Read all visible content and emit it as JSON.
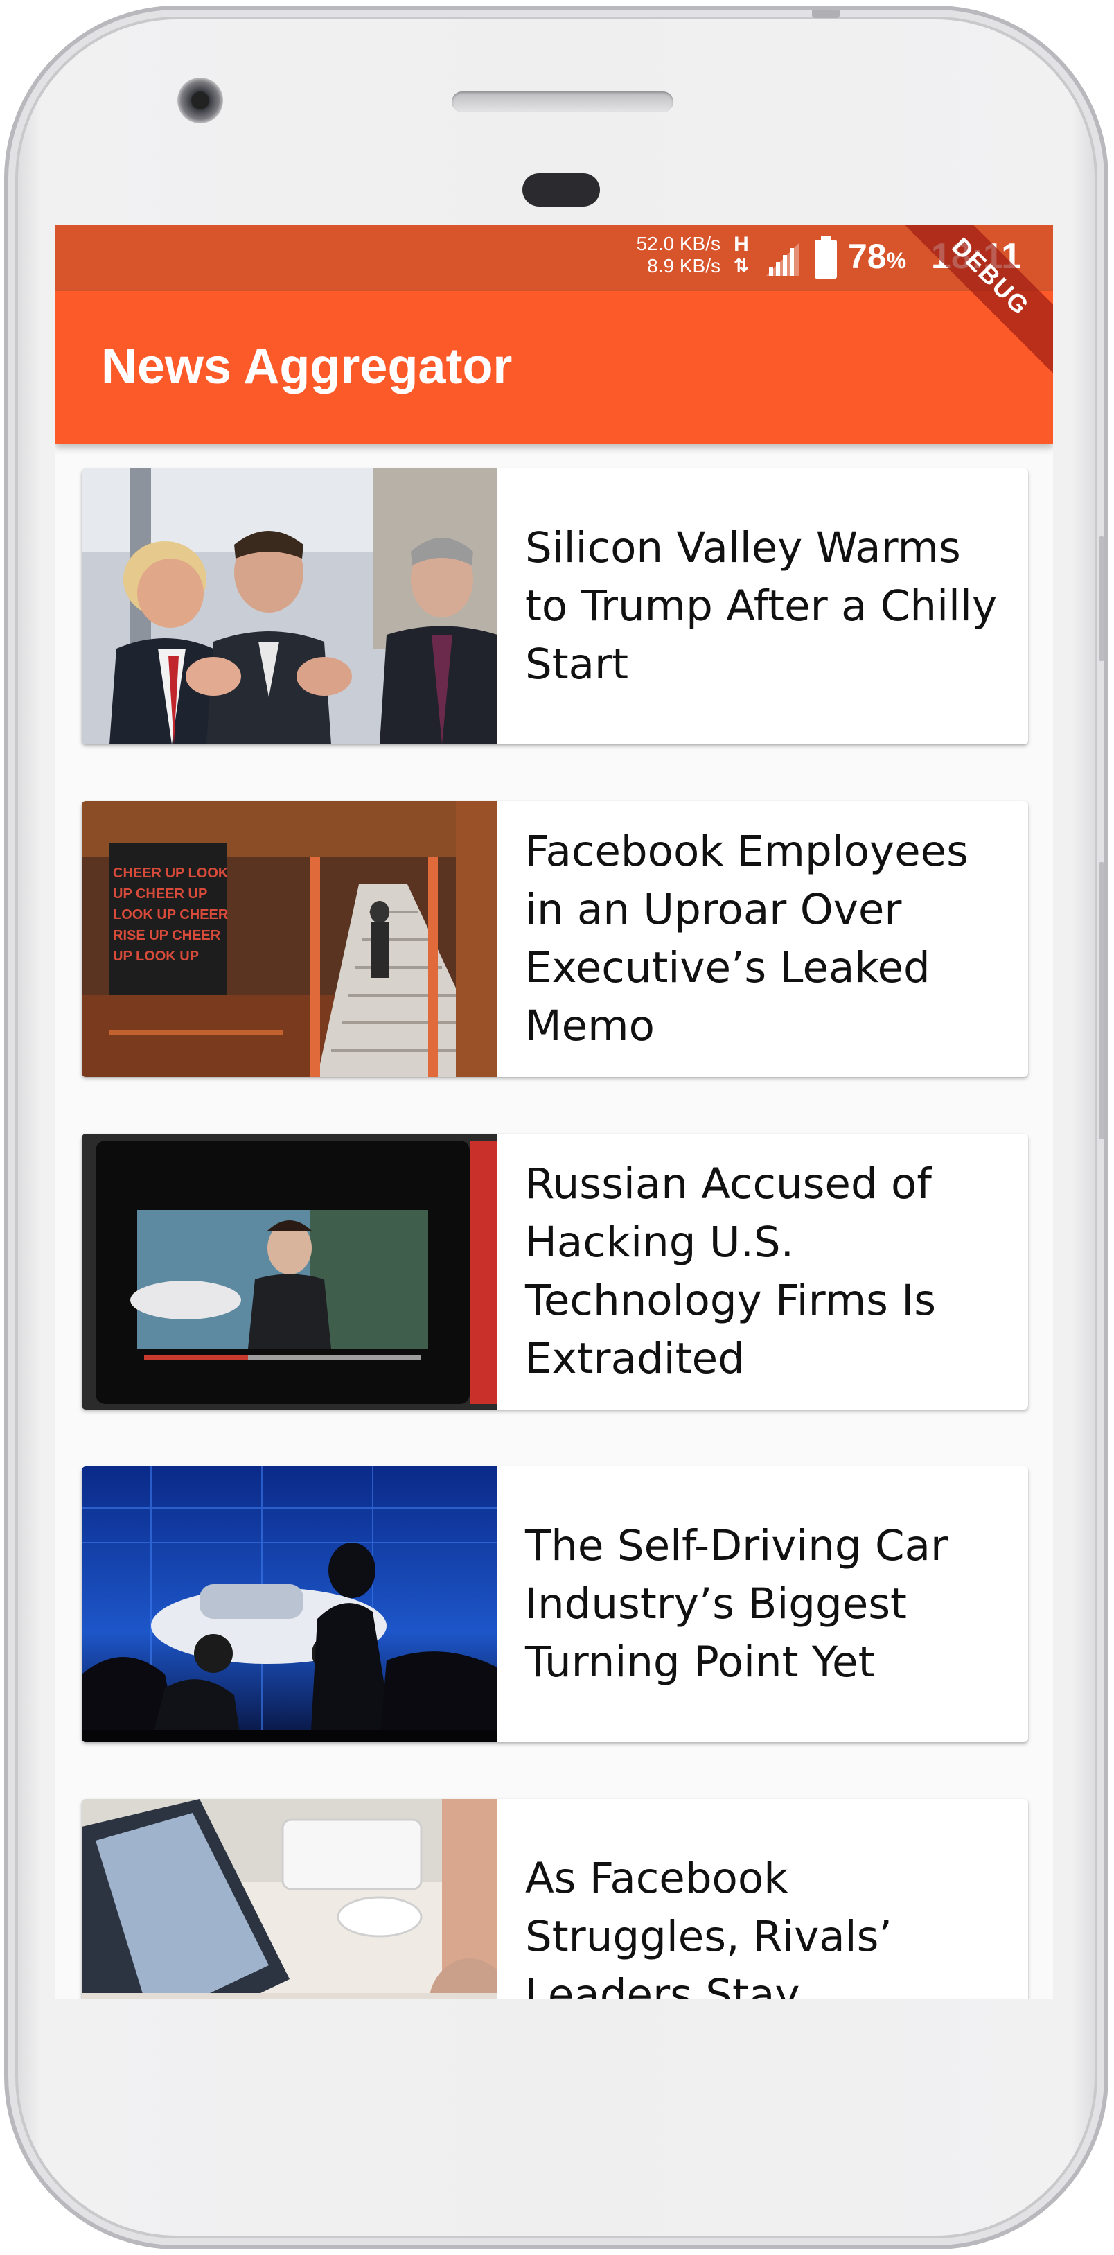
{
  "status_bar": {
    "net_speed_up": "52.0 KB/s",
    "net_speed_down": "8.9 KB/s",
    "network_type": "H",
    "battery_percent": "78",
    "battery_unit": "%",
    "time": "18:11",
    "debug_label": "DEBUG",
    "icons": [
      "network-arrows-icon",
      "signal-icon",
      "battery-icon"
    ]
  },
  "app_bar": {
    "title": "News Aggregator",
    "color": "#fd5a2a",
    "status_color": "#d8552c"
  },
  "articles": [
    {
      "title": "Silicon Valley Warms to Trump After a Chilly Start"
    },
    {
      "title": "Facebook Employees in an Uproar Over Executive’s Leaked Memo"
    },
    {
      "title": "Russian Accused of Hacking U.S. Technology Firms Is Extradited"
    },
    {
      "title": "The Self-Driving Car Industry’s Biggest Turning Point Yet"
    },
    {
      "title": "As Facebook Struggles, Rivals’ Leaders Stay"
    }
  ]
}
